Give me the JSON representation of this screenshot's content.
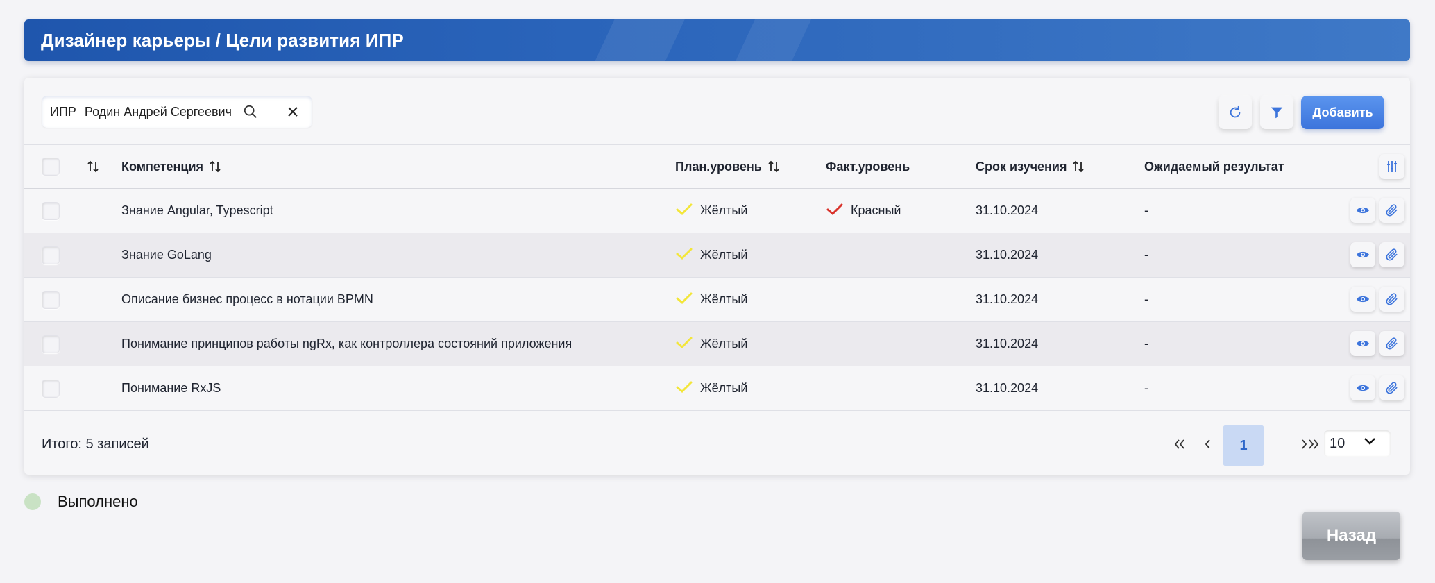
{
  "header": {
    "title": "Дизайнер карьеры / Цели развития ИПР"
  },
  "search": {
    "prefix": "ИПР",
    "value": "Родин Андрей Сергеевич"
  },
  "toolbar": {
    "add_label": "Добавить"
  },
  "table": {
    "columns": {
      "competence": "Компетенция",
      "plan_level": "План.уровень",
      "fact_level": "Факт.уровень",
      "study_term": "Срок изучения",
      "expected_result": "Ожидаемый результат"
    },
    "rows": [
      {
        "competence": "Знание Angular, Typescript",
        "plan_level": "Жёлтый",
        "fact_level": "Красный",
        "study_term": "31.10.2024",
        "expected_result": "-"
      },
      {
        "competence": "Знание GoLang",
        "plan_level": "Жёлтый",
        "fact_level": "",
        "study_term": "31.10.2024",
        "expected_result": "-"
      },
      {
        "competence": "Описание бизнес процесс в нотации BPMN",
        "plan_level": "Жёлтый",
        "fact_level": "",
        "study_term": "31.10.2024",
        "expected_result": "-"
      },
      {
        "competence": "Понимание принципов работы ngRx, как контроллера состояний приложения",
        "plan_level": "Жёлтый",
        "fact_level": "",
        "study_term": "31.10.2024",
        "expected_result": "-"
      },
      {
        "competence": "Понимание RxJS",
        "plan_level": "Жёлтый",
        "fact_level": "",
        "study_term": "31.10.2024",
        "expected_result": "-"
      }
    ]
  },
  "colors": {
    "yellow": "#f3e63a",
    "red": "#d9322b",
    "accent": "#3c74dc",
    "done": "#c9e2c4"
  },
  "footer": {
    "total": "Итого: 5 записей",
    "current_page": "1",
    "page_size": "10"
  },
  "legend": {
    "done_label": "Выполнено"
  },
  "back_button": {
    "label": "Назад"
  }
}
